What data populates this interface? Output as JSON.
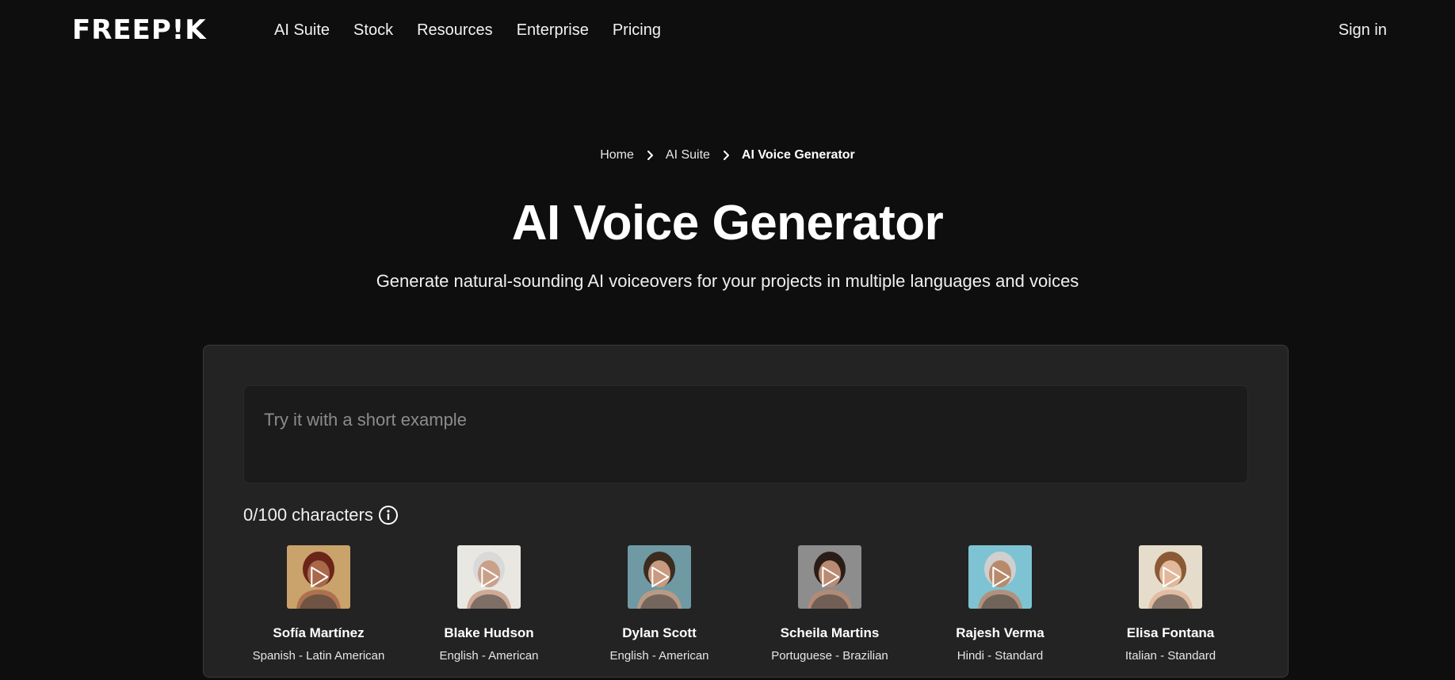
{
  "header": {
    "logo": "FREEP!K",
    "nav": [
      "AI Suite",
      "Stock",
      "Resources",
      "Enterprise",
      "Pricing"
    ],
    "sign_in": "Sign in"
  },
  "breadcrumb": {
    "items": [
      "Home",
      "AI Suite"
    ],
    "current": "AI Voice Generator"
  },
  "hero": {
    "title": "AI Voice Generator",
    "subtitle": "Generate natural-sounding AI voiceovers for your projects in multiple languages and voices"
  },
  "generator": {
    "placeholder": "Try it with a short example",
    "char_count": "0/100 characters",
    "voices": [
      {
        "name": "Sofía Martínez",
        "lang": "Spanish - Latin American",
        "bg": "#c9a36b",
        "skin": "#a9684a",
        "hair": "#6b2418"
      },
      {
        "name": "Blake Hudson",
        "lang": "English - American",
        "bg": "#e9e7e2",
        "skin": "#c9a089",
        "hair": "#d9d9d9"
      },
      {
        "name": "Dylan Scott",
        "lang": "English - American",
        "bg": "#6f9aa4",
        "skin": "#c89a80",
        "hair": "#3b2c20"
      },
      {
        "name": "Scheila Martins",
        "lang": "Portuguese - Brazilian",
        "bg": "#8d8d8d",
        "skin": "#b98b72",
        "hair": "#2a1d18"
      },
      {
        "name": "Rajesh Verma",
        "lang": "Hindi - Standard",
        "bg": "#7ec3d3",
        "skin": "#b88a6c",
        "hair": "#cfcfcf"
      },
      {
        "name": "Elisa Fontana",
        "lang": "Italian - Standard",
        "bg": "#e6dccb",
        "skin": "#e2b79a",
        "hair": "#8a5a36"
      }
    ]
  },
  "colors": {
    "page_bg": "#0e0e0e",
    "panel_bg": "#232323",
    "input_bg": "#1b1b1b"
  }
}
